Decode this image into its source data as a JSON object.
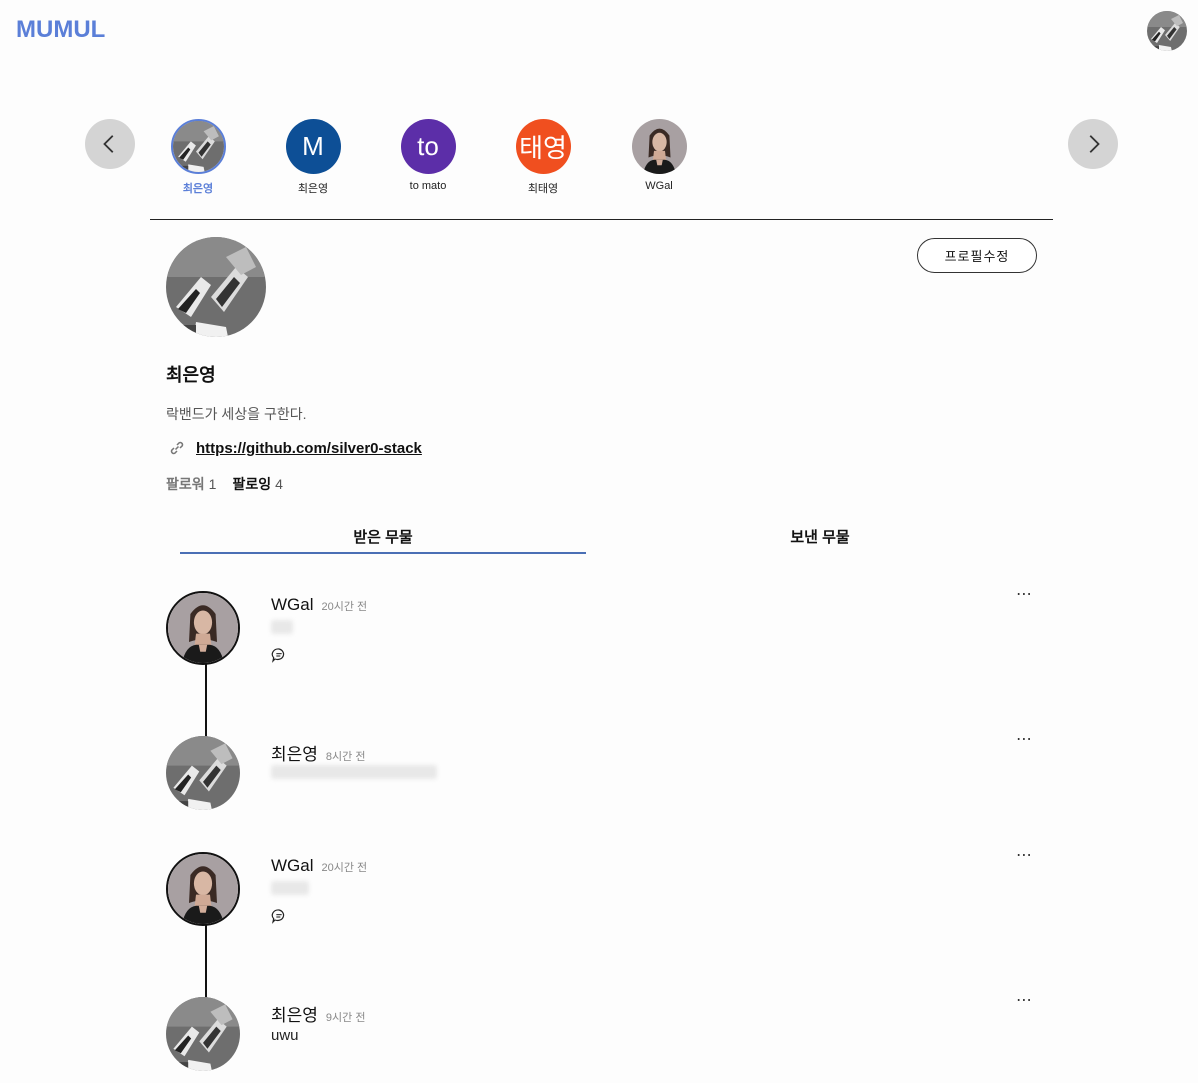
{
  "app": {
    "logo": "MUMUL"
  },
  "friends": [
    {
      "name": "최은영",
      "initial": "",
      "type": "photo-shoes",
      "selected": true
    },
    {
      "name": "최은영",
      "initial": "M",
      "type": "letter",
      "color": "#0d4f96"
    },
    {
      "name": "to mato",
      "initial": "to",
      "type": "letter",
      "color": "#5c2ea8"
    },
    {
      "name": "최태영",
      "initial": "태영",
      "type": "letter",
      "color": "#f04f1f"
    },
    {
      "name": "WGal",
      "initial": "",
      "type": "photo-woman"
    }
  ],
  "profile": {
    "name": "최은영",
    "bio": "락밴드가 세상을 구한다.",
    "link": "https://github.com/silver0-stack",
    "edit_label": "프로필수정",
    "followers_label": "팔로워",
    "followers_count": "1",
    "following_label": "팔로잉",
    "following_count": "4"
  },
  "tabs": {
    "received": "받은 무물",
    "sent": "보낸 무물"
  },
  "posts": [
    {
      "author": "WGal",
      "time": "20시간 전",
      "body": "",
      "avatar": "woman",
      "has_reply": true
    },
    {
      "author": "최은영",
      "time": "8시간 전",
      "body": "",
      "avatar": "shoes",
      "has_reply": false
    },
    {
      "author": "WGal",
      "time": "20시간 전",
      "body": "",
      "avatar": "woman",
      "has_reply": true
    },
    {
      "author": "최은영",
      "time": "9시간 전",
      "body": "uwu",
      "avatar": "shoes",
      "has_reply": false
    }
  ],
  "icons": {
    "more": "⋯",
    "link": "link-icon",
    "reply": "comment-icon"
  },
  "colors": {
    "accent": "#5b7fd8",
    "tab_underline": "#4a6fb5"
  }
}
